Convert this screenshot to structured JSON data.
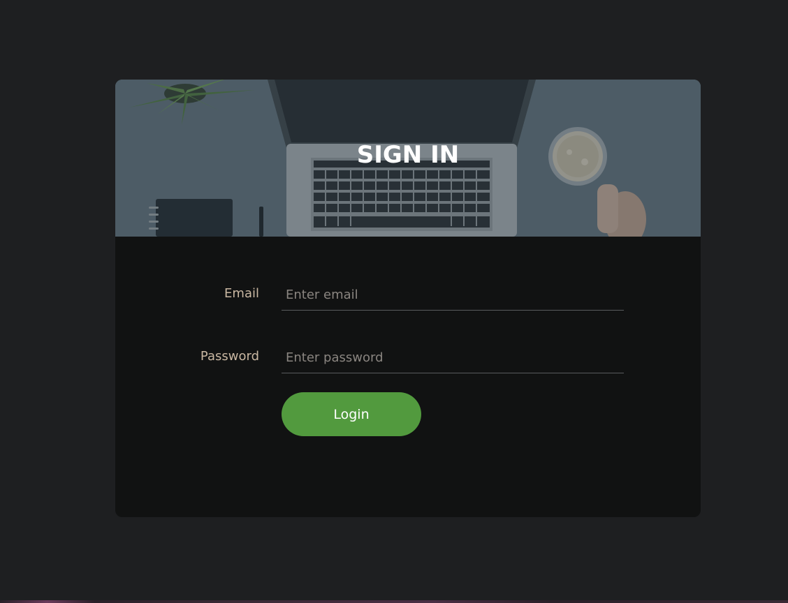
{
  "hero": {
    "title": "SIGN IN"
  },
  "form": {
    "email_label": "Email",
    "email_placeholder": "Enter email",
    "email_value": "",
    "password_label": "Password",
    "password_placeholder": "Enter password",
    "password_value": "",
    "login_label": "Login"
  },
  "colors": {
    "page_background": "#1e1f21",
    "card_background": "#111212",
    "accent": "#529a3e",
    "label": "#c9b7a2"
  },
  "icons": {
    "hero_image": "desk-laptop-coffee-image"
  }
}
